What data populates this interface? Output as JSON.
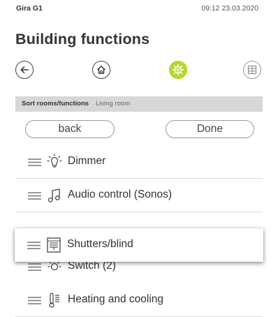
{
  "status": {
    "device": "Gira G1",
    "clock": "09:12 23.03.2020"
  },
  "page": {
    "title": "Building functions"
  },
  "nav": {
    "items": [
      {
        "name": "back-icon"
      },
      {
        "name": "home-icon"
      },
      {
        "name": "functions-icon",
        "active": true
      },
      {
        "name": "rooms-grid-icon"
      }
    ],
    "accent": "#b3d82a"
  },
  "sort": {
    "title": "Sort rooms/functions",
    "room": "Living room"
  },
  "buttons": {
    "back": "back",
    "done": "Done"
  },
  "functions": [
    {
      "label": "Dimmer",
      "icon": "dimmer-bulb-icon"
    },
    {
      "label": "Audio control (Sonos)",
      "icon": "music-note-icon"
    },
    {
      "label": "Switch (2)",
      "icon": "switch-bulb-icon"
    },
    {
      "label": "Heating and cooling",
      "icon": "heating-icon"
    }
  ],
  "dragged": {
    "label": "Shutters/blind",
    "icon": "shutter-icon"
  }
}
